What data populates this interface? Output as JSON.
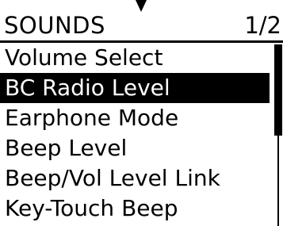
{
  "header": {
    "title": "SOUNDS",
    "page_indicator": "1/2"
  },
  "menu": {
    "items": [
      {
        "label": "Volume Select",
        "selected": false
      },
      {
        "label": "BC Radio Level",
        "selected": true
      },
      {
        "label": "Earphone Mode",
        "selected": false
      },
      {
        "label": "Beep Level",
        "selected": false
      },
      {
        "label": "Beep/Vol Level Link",
        "selected": false
      },
      {
        "label": "Key-Touch Beep",
        "selected": false
      }
    ]
  },
  "scroll": {
    "position_fraction": 0.0,
    "visible_fraction": 0.5
  },
  "colors": {
    "background": "#ffffff",
    "foreground": "#000000",
    "highlight_background": "#000000",
    "highlight_text": "#ffffff"
  },
  "icons": {
    "pointer": "down-arrow-icon"
  }
}
